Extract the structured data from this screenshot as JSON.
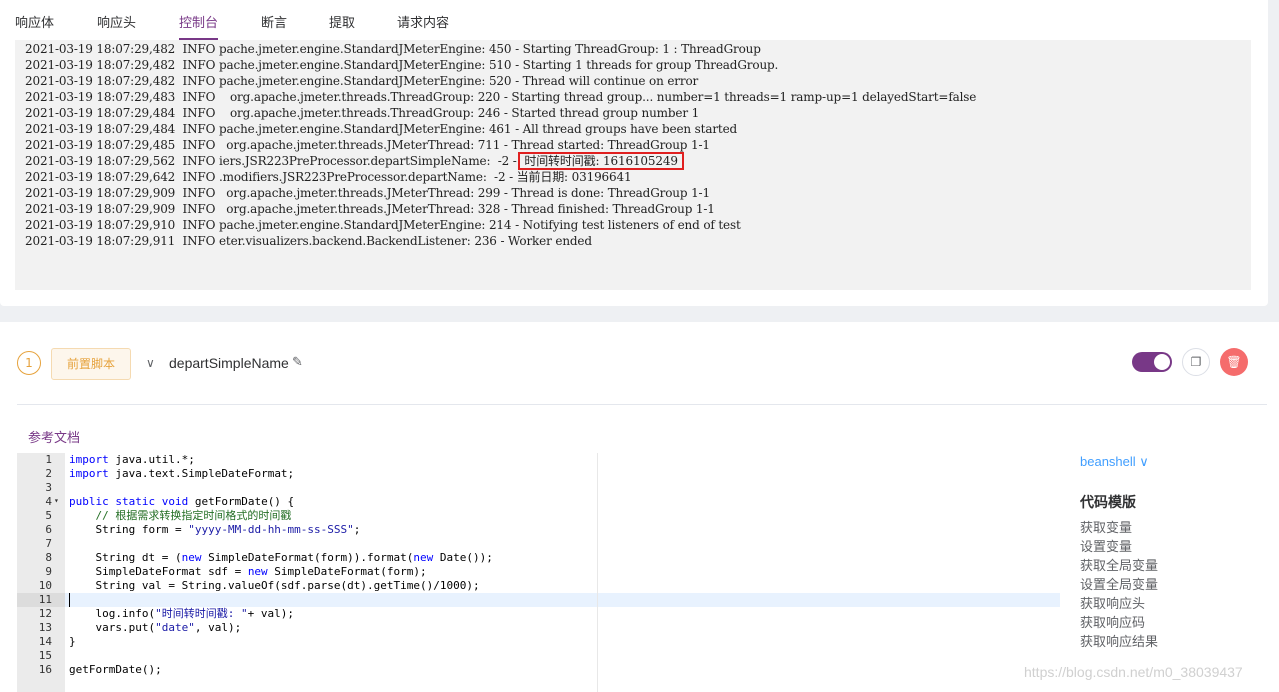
{
  "tabs": [
    "响应体",
    "响应头",
    "控制台",
    "断言",
    "提取",
    "请求内容"
  ],
  "active_tab": "控制台",
  "console": {
    "lines": [
      "2021-03-19 18:07:29,482  INFO pache.jmeter.engine.StandardJMeterEngine: 450 - Starting ThreadGroup: 1 : ThreadGroup",
      "2021-03-19 18:07:29,482  INFO pache.jmeter.engine.StandardJMeterEngine: 510 - Starting 1 threads for group ThreadGroup.",
      "2021-03-19 18:07:29,482  INFO pache.jmeter.engine.StandardJMeterEngine: 520 - Thread will continue on error",
      "2021-03-19 18:07:29,483  INFO    org.apache.jmeter.threads.ThreadGroup: 220 - Starting thread group... number=1 threads=1 ramp-up=1 delayedStart=false",
      "2021-03-19 18:07:29,484  INFO    org.apache.jmeter.threads.ThreadGroup: 246 - Started thread group number 1",
      "2021-03-19 18:07:29,484  INFO pache.jmeter.engine.StandardJMeterEngine: 461 - All thread groups have been started",
      "2021-03-19 18:07:29,485  INFO   org.apache.jmeter.threads.JMeterThread: 711 - Thread started: ThreadGroup 1-1",
      "2021-03-19 18:07:29,562  INFO iers.JSR223PreProcessor.departSimpleName:  -2 - ",
      "2021-03-19 18:07:29,642  INFO .modifiers.JSR223PreProcessor.departName:  -2 - 当前日期: 03196641",
      "2021-03-19 18:07:29,909  INFO   org.apache.jmeter.threads.JMeterThread: 299 - Thread is done: ThreadGroup 1-1",
      "2021-03-19 18:07:29,909  INFO   org.apache.jmeter.threads.JMeterThread: 328 - Thread finished: ThreadGroup 1-1",
      "2021-03-19 18:07:29,910  INFO pache.jmeter.engine.StandardJMeterEngine: 214 - Notifying test listeners of end of test",
      "2021-03-19 18:07:29,911  INFO eter.visualizers.backend.BackendListener: 236 - Worker ended"
    ],
    "highlight_text": "时间转时间戳: 1616105249"
  },
  "step": {
    "number": "1",
    "tag": "前置脚本",
    "name": "departSimpleName",
    "enabled": true
  },
  "doc_link": "参考文档",
  "editor": {
    "line_numbers": [
      "1",
      "2",
      "3",
      "4",
      "5",
      "6",
      "7",
      "8",
      "9",
      "10",
      "11",
      "12",
      "13",
      "14",
      "15",
      "16"
    ],
    "active_line": "11"
  },
  "language": "beanshell",
  "templates": {
    "title": "代码模版",
    "items": [
      "获取变量",
      "设置变量",
      "获取全局变量",
      "设置全局变量",
      "获取响应头",
      "获取响应码",
      "获取响应结果"
    ]
  },
  "watermark": "https://blog.csdn.net/m0_38039437",
  "colors": {
    "accent": "#783887",
    "warning": "#e6a23c",
    "danger": "#f56c6c",
    "link": "#409eff"
  }
}
